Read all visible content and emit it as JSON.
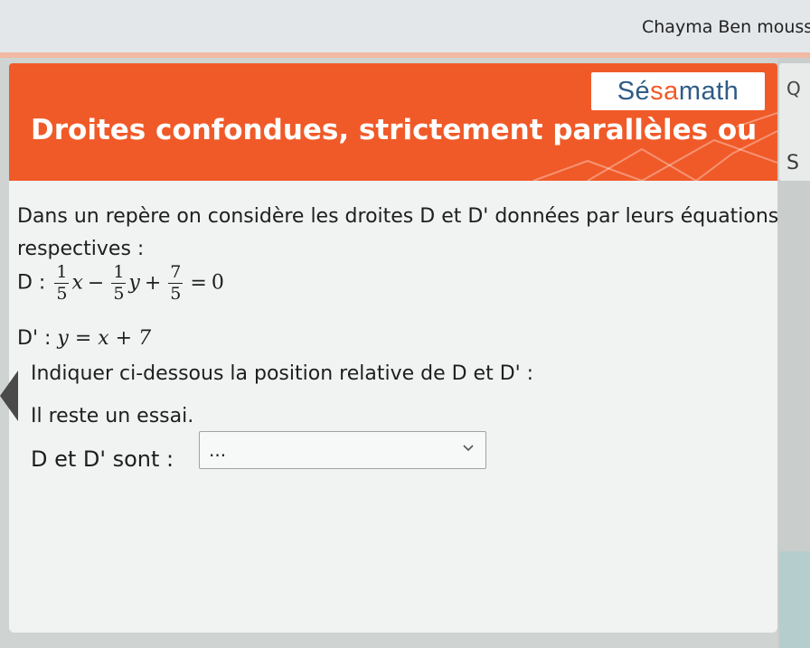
{
  "user": {
    "name": "Chayma Ben moussa - /"
  },
  "logo": {
    "part1": "Sé",
    "part2": "sa",
    "part3": "math"
  },
  "banner": {
    "title": "Droites confondues, strictement parallèles ou"
  },
  "side": {
    "tab1_letter": "Q",
    "tab2_letter": "S"
  },
  "question": {
    "intro_line1": "Dans un repère on considère les droites D et D' données par leurs équations",
    "intro_line2": "respectives :",
    "eq1_label": "D :",
    "eq1": {
      "a_num": "1",
      "a_den": "5",
      "x": "x",
      "minus": "−",
      "b_num": "1",
      "b_den": "5",
      "y": "y",
      "plus": "+",
      "c_num": "7",
      "c_den": "5",
      "equals": "=",
      "rhs": "0"
    },
    "eq2_label": "D' :",
    "eq2": "y = x + 7",
    "instruction": "Indiquer ci-dessous la position relative de D et D' :",
    "attempts": "Il reste un essai.",
    "answer_label": "D et D' sont :",
    "answer_value": "...",
    "chevron_icon": "chevron-down-icon"
  },
  "colors": {
    "brand_orange": "#f05a28",
    "logo_blue": "#2f5b86"
  }
}
